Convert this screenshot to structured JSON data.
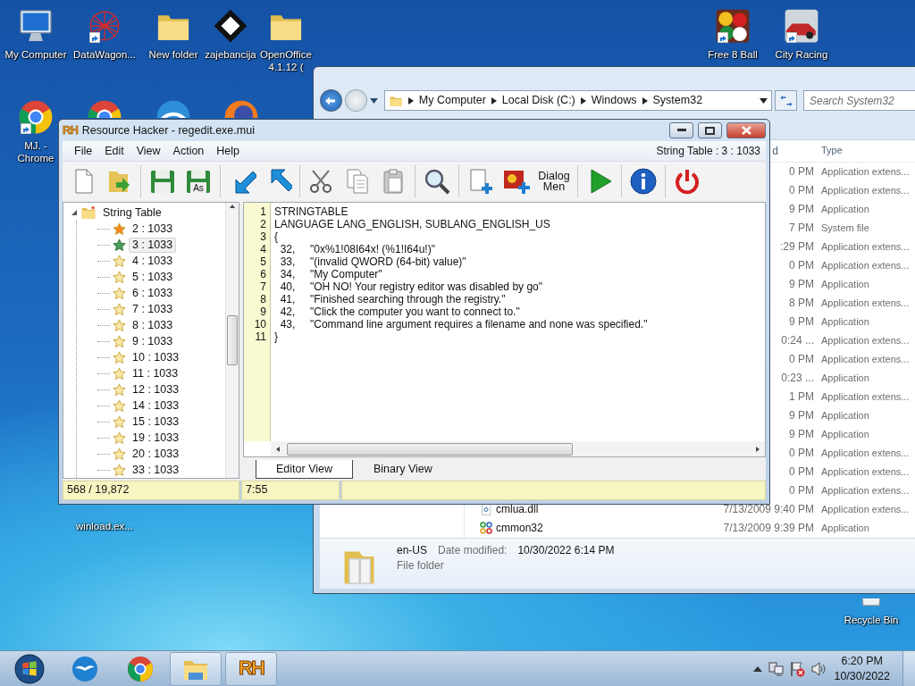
{
  "desktop_icons": [
    {
      "label": "My Computer",
      "kind": "computer",
      "shortcut": false
    },
    {
      "label": "DataWagon...",
      "kind": "web",
      "shortcut": true
    },
    {
      "label": "New folder",
      "kind": "folder",
      "shortcut": false
    },
    {
      "label": "zajebancija",
      "kind": "diamond",
      "shortcut": false
    },
    {
      "label": "OpenOffice 4.1.12 (",
      "kind": "folder",
      "shortcut": false
    },
    {
      "label": "Free 8 Ball",
      "kind": "game",
      "shortcut": true
    },
    {
      "label": "City Racing",
      "kind": "car",
      "shortcut": true
    },
    {
      "label": "MJ. - Chrome",
      "kind": "chrome",
      "shortcut": true
    },
    {
      "kind": "chrome"
    },
    {
      "kind": "globe"
    },
    {
      "kind": "fox"
    },
    {
      "label": "winload.ex...",
      "kind": "none"
    },
    {
      "label": "Recycle Bin",
      "kind": "bin"
    }
  ],
  "explorer": {
    "breadcrumb": [
      "My Computer",
      "Local Disk (C:)",
      "Windows",
      "System32"
    ],
    "search": {
      "placeholder": "Search System32"
    },
    "columns": [
      "d",
      "Type"
    ],
    "rows": [
      {
        "date": "0 PM",
        "type": "Application extens..."
      },
      {
        "date": "0 PM",
        "type": "Application extens..."
      },
      {
        "date": "9 PM",
        "type": "Application"
      },
      {
        "date": "7 PM",
        "type": "System file"
      },
      {
        "date": ":29 PM",
        "type": "Application extens..."
      },
      {
        "date": "0 PM",
        "type": "Application extens..."
      },
      {
        "date": "9 PM",
        "type": "Application"
      },
      {
        "date": "8 PM",
        "type": "Application extens..."
      },
      {
        "date": "9 PM",
        "type": "Application"
      },
      {
        "date": "0:24 ...",
        "type": "Application extens..."
      },
      {
        "date": "0 PM",
        "type": "Application extens..."
      },
      {
        "date": "0:23 ...",
        "type": "Application"
      },
      {
        "date": "1 PM",
        "type": "Application extens..."
      },
      {
        "date": "9 PM",
        "type": "Application"
      },
      {
        "date": "9 PM",
        "type": "Application"
      },
      {
        "date": "0 PM",
        "type": "Application extens..."
      },
      {
        "date": "0 PM",
        "type": "Application extens..."
      },
      {
        "date": "0 PM",
        "type": "Application extens..."
      },
      {
        "name": "cmlua.dll",
        "kind": "dll",
        "date": "7/13/2009 9:40 PM",
        "type": "Application extens..."
      },
      {
        "name": "cmmon32",
        "kind": "exe",
        "date": "7/13/2009 9:39 PM",
        "type": "Application"
      }
    ],
    "details": {
      "name": "en-US",
      "date_label": "Date modified:",
      "date": "10/30/2022 6:14 PM",
      "type": "File folder"
    }
  },
  "resource_hacker": {
    "icon_text": "RH",
    "title": "Resource Hacker - regedit.exe.mui",
    "menu": [
      "File",
      "Edit",
      "View",
      "Action",
      "Help"
    ],
    "location": "String Table : 3 : 1033",
    "toolbar": [
      {
        "kind": "new"
      },
      {
        "kind": "open"
      },
      {
        "kind": "sep"
      },
      {
        "kind": "save"
      },
      {
        "kind": "save-as",
        "label": "As"
      },
      {
        "kind": "sep"
      },
      {
        "kind": "arrow-down"
      },
      {
        "kind": "arrow-up"
      },
      {
        "kind": "sep"
      },
      {
        "kind": "cut"
      },
      {
        "kind": "copy"
      },
      {
        "kind": "paste"
      },
      {
        "kind": "sep"
      },
      {
        "kind": "find"
      },
      {
        "kind": "sep"
      },
      {
        "kind": "add"
      },
      {
        "kind": "image"
      },
      {
        "kind": "dialog",
        "label": "Dialog",
        "label2": "Men"
      },
      {
        "kind": "sep"
      },
      {
        "kind": "run"
      },
      {
        "kind": "sep"
      },
      {
        "kind": "info"
      },
      {
        "kind": "sep"
      },
      {
        "kind": "power"
      }
    ],
    "tree": {
      "label": "String Table",
      "expanded": true,
      "children": [
        {
          "label": "2 : 1033",
          "color": "#f28a1e",
          "selected": false
        },
        {
          "label": "3 : 1033",
          "color": "#4c9f5a",
          "selected": true
        },
        {
          "label": "4 : 1033",
          "color": "#f7e9a8",
          "selected": false
        },
        {
          "label": "5 : 1033",
          "color": "#f7e9a8",
          "selected": false
        },
        {
          "label": "6 : 1033",
          "color": "#f7e9a8",
          "selected": false
        },
        {
          "label": "7 : 1033",
          "color": "#f7e9a8",
          "selected": false
        },
        {
          "label": "8 : 1033",
          "color": "#f7e9a8",
          "selected": false
        },
        {
          "label": "9 : 1033",
          "color": "#f7e9a8",
          "selected": false
        },
        {
          "label": "10 : 1033",
          "color": "#f7e9a8",
          "selected": false
        },
        {
          "label": "11 : 1033",
          "color": "#f7e9a8",
          "selected": false
        },
        {
          "label": "12 : 1033",
          "color": "#f7e9a8",
          "selected": false
        },
        {
          "label": "14 : 1033",
          "color": "#f7e9a8",
          "selected": false
        },
        {
          "label": "15 : 1033",
          "color": "#f7e9a8",
          "selected": false
        },
        {
          "label": "19 : 1033",
          "color": "#f7e9a8",
          "selected": false
        },
        {
          "label": "20 : 1033",
          "color": "#f7e9a8",
          "selected": false
        },
        {
          "label": "33 : 1033",
          "color": "#f7e9a8",
          "selected": false
        }
      ]
    },
    "editor": {
      "lines": [
        {
          "number": "1",
          "text": "STRINGTABLE"
        },
        {
          "number": "2",
          "text": "LANGUAGE LANG_ENGLISH, SUBLANG_ENGLISH_US"
        },
        {
          "number": "3",
          "text": "{"
        },
        {
          "number": "4",
          "text": "  32,     \"0x%1!08I64x! (%1!I64u!)\""
        },
        {
          "number": "5",
          "text": "  33,     \"(invalid QWORD (64-bit) value)\""
        },
        {
          "number": "6",
          "text": "  34,     \"My Computer\""
        },
        {
          "number": "7",
          "text": "  40,     \"OH NO! Your registry editor was disabled by go\""
        },
        {
          "number": "8",
          "text": "  41,     \"Finished searching through the registry.\""
        },
        {
          "number": "9",
          "text": "  42,     \"Click the computer you want to connect to.\""
        },
        {
          "number": "10",
          "text": "  43,     \"Command line argument requires a filename and none was specified.\""
        },
        {
          "number": "11",
          "text": "}"
        }
      ]
    },
    "tabs": [
      {
        "label": "Editor View",
        "selected": true
      },
      {
        "label": "Binary View",
        "selected": false
      }
    ],
    "status": [
      "568 / 19,872",
      "7:55"
    ]
  },
  "taskbar": {
    "items": [
      {
        "kind": "start",
        "running": false
      },
      {
        "kind": "openoffice",
        "running": false
      },
      {
        "kind": "chrome",
        "running": false
      },
      {
        "kind": "explorer",
        "running": true
      },
      {
        "kind": "rh",
        "running": true,
        "label": "RH"
      }
    ],
    "clock": {
      "time": "6:20 PM",
      "date": "10/30/2022"
    }
  }
}
